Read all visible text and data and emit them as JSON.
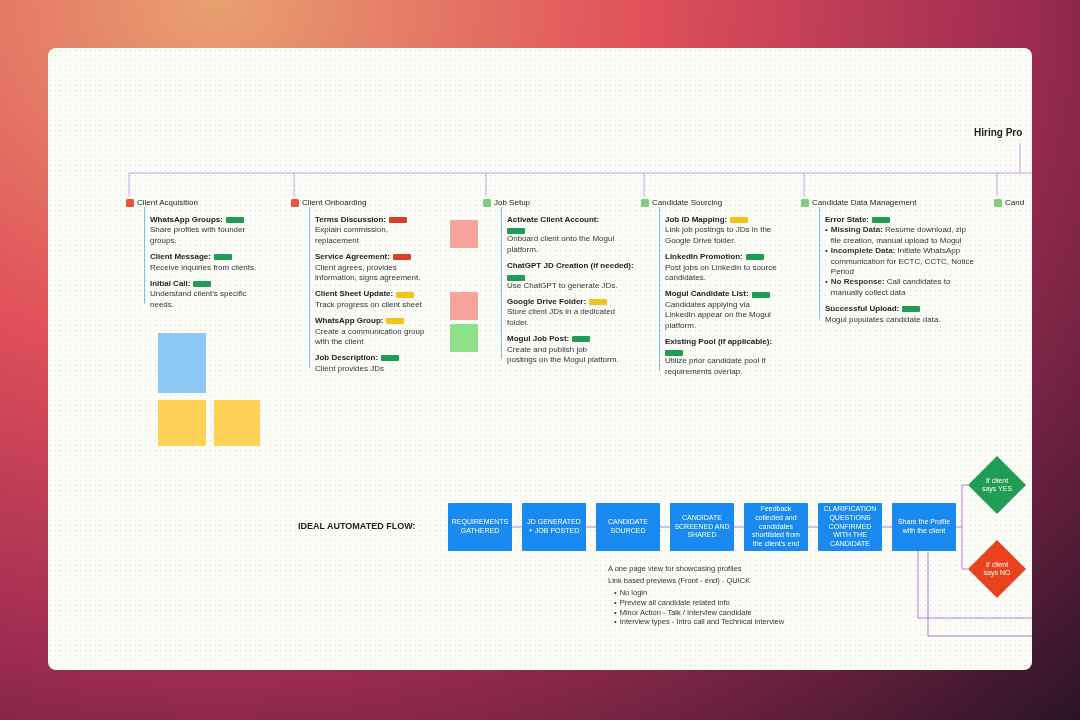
{
  "board": {
    "title": "Hiring Pro",
    "sections": [
      {
        "title": "Client Acquisition",
        "color": "#e8553a",
        "items": [
          {
            "label": "WhatsApp Groups:",
            "color": "#1f9d55",
            "text": "Share profiles with founder groups."
          },
          {
            "label": "Client Message:",
            "color": "#1f9d55",
            "text": "Receive inquiries from clients."
          },
          {
            "label": "Initial Call:",
            "color": "#1f9d55",
            "text": "Understand client's specific needs."
          }
        ]
      },
      {
        "title": "Client Onboarding",
        "color": "#e8553a",
        "items": [
          {
            "label": "Terms Discussion:",
            "color": "#d9402a",
            "text": "Explain commission, replacement"
          },
          {
            "label": "Service Agreement:",
            "color": "#d9402a",
            "text": "Client agrees, provides information, signs agreement."
          },
          {
            "label": "Client Sheet Update:",
            "color": "#f2c318",
            "text": "Track progress on client sheet"
          },
          {
            "label": "WhatsApp Group:",
            "color": "#f2c318",
            "text": "Create a communication group with the client"
          },
          {
            "label": "Job Description:",
            "color": "#1f9d55",
            "text": "Client provides JDs"
          }
        ]
      },
      {
        "title": "Job Setup",
        "color": "#7ccf7a",
        "items": [
          {
            "label": "Activate Client Account:",
            "color": "#1f9d55",
            "text": "Onboard client onto the Mogul platform."
          },
          {
            "label": "ChatGPT JD Creation (if needed):",
            "color": "#1f9d55",
            "text": "Use ChatGPT to generate JDs."
          },
          {
            "label": "Google Drive Folder:",
            "color": "#f2c318",
            "text": "Store client JDs in a dedicated folder."
          },
          {
            "label": "Mogul Job Post:",
            "color": "#1f9d55",
            "text": "Create and publish job postings on the Mogul platform."
          }
        ]
      },
      {
        "title": "Candidate Sourcing",
        "color": "#7ccf7a",
        "items": [
          {
            "label": "Job ID Mapping:",
            "color": "#f2c318",
            "text": "Link job postings to JDs in the Google Drive folder."
          },
          {
            "label": "LinkedIn Promotion:",
            "color": "#1f9d55",
            "text": "Post jobs on LinkedIn to source candidates."
          },
          {
            "label": "Mogul Candidate List:",
            "color": "#1f9d55",
            "text": "Candidates applying via LinkedIn appear on the Mogul platform."
          },
          {
            "label": "Existing Pool (if applicable):",
            "color": "#1f9d55",
            "text": "Utilize prior candidate pool if requirements overlap."
          }
        ]
      },
      {
        "title": "Candidate Data Management",
        "color": "#7ccf7a",
        "items": [
          {
            "label": "Error State:",
            "color": "#1f9d55",
            "bullets": [
              {
                "marker": "•",
                "text": "**Missing Data:** Resume download, zip file creation, manual upload to Mogul"
              },
              {
                "marker": "•",
                "text": "**Incomplete Data:** Initiate WhatsApp communication for ECTC, CCTC, Notice Period"
              },
              {
                "marker": "•",
                "text": "**No Response:** Call candidates to manually collect data"
              }
            ]
          },
          {
            "label": "Successful Upload:",
            "color": "#1f9d55",
            "text": "Mogul populates candidate data."
          }
        ]
      },
      {
        "title": "Cand",
        "color": "#7ccf7a"
      }
    ],
    "notes": [
      {
        "color": "#8ec9f5"
      },
      {
        "color": "#fdd257"
      },
      {
        "color": "#fdd257"
      },
      {
        "color": "#f7a59a"
      },
      {
        "color": "#f7a59a"
      },
      {
        "color": "#8fe08a"
      }
    ]
  },
  "flow": {
    "title": "IDEAL AUTOMATED FLOW:",
    "steps": [
      "REQUIREMENTS GATHERED",
      "JD GENERATED + JOB POSTED",
      "CANDIDATE SOURCED",
      "CANDIDATE SCREENED AND SHARED",
      "Feedback collected and candidates shortlisted from the client's end",
      "CLARIFICATION QUESTIONS CONFIRMED WITH THE CANDIDATE",
      "Share the Profile with the client"
    ],
    "decisions": [
      {
        "text": "If client says YES",
        "color": "#1f9d55"
      },
      {
        "text": "If client says NO",
        "color": "#e8431c"
      }
    ],
    "memo": {
      "lines": [
        "A one page view for showcasing profiles",
        "Link based previews (Front - end) - QUICK"
      ],
      "bullets": [
        {
          "marker": "•",
          "text": "No login"
        },
        {
          "marker": "•",
          "text": "Preview all candidate related info"
        },
        {
          "marker": "•",
          "text": "Minor Action - Talk / Interview candidate"
        },
        {
          "marker": "•",
          "text": "Interview types - Intro call and Technical interview"
        }
      ]
    }
  }
}
